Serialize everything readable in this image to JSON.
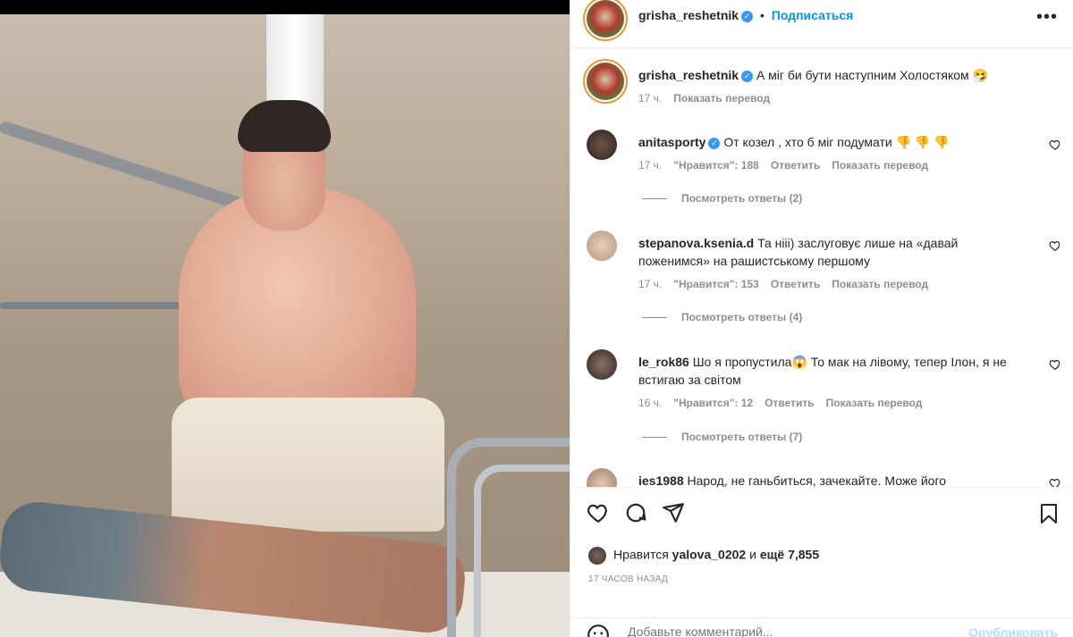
{
  "post": {
    "author": "grisha_reshetnik",
    "follow_label": "Подписаться",
    "caption": "А міг би бути наступним Холостяком 🤧",
    "caption_time": "17 ч.",
    "caption_translate": "Показать перевод"
  },
  "comments": [
    {
      "user": "anitasporty",
      "text": "От козел , хто б міг подумати 👎 👎 👎",
      "time": "17 ч.",
      "likes": "\"Нравится\": 188",
      "reply": "Ответить",
      "translate": "Показать перевод",
      "view_replies": "Посмотреть ответы (2)"
    },
    {
      "user": "stepanova.ksenia.d",
      "text": "Та нііі) заслуговує лише на «давай поженимся» на рашистському першому",
      "time": "17 ч.",
      "likes": "\"Нравится\": 153",
      "reply": "Ответить",
      "translate": "Показать перевод",
      "view_replies": "Посмотреть ответы (4)"
    },
    {
      "user": "le_rok86",
      "text": "Шо я пропустила😱 То мак на лівому, тепер Ілон, я не встигаю за світом",
      "time": "16 ч.",
      "likes": "\"Нравится\": 12",
      "reply": "Ответить",
      "translate": "Показать перевод",
      "view_replies": "Посмотреть ответы (7)"
    },
    {
      "user": "ies1988",
      "text": "Народ, не ганьбиться, зачекайте. Може його"
    }
  ],
  "likes_bar": {
    "prefix": "Нравится",
    "liker": "yalova_0202",
    "and": "и",
    "more": "ещё 7,855"
  },
  "timestamp": "17 ЧАСОВ НАЗАД",
  "add_comment": {
    "placeholder": "Добавьте комментарий...",
    "post_label": "Опубликовать"
  },
  "icons": {
    "verified": "verified-badge-icon",
    "more": "more-options-icon",
    "like": "heart-icon",
    "comment": "comment-icon",
    "share": "share-icon",
    "save": "bookmark-icon",
    "emoji": "smile-icon"
  },
  "colors": {
    "accent": "#0095f6",
    "muted": "#8e8e8e",
    "text": "#262626"
  }
}
